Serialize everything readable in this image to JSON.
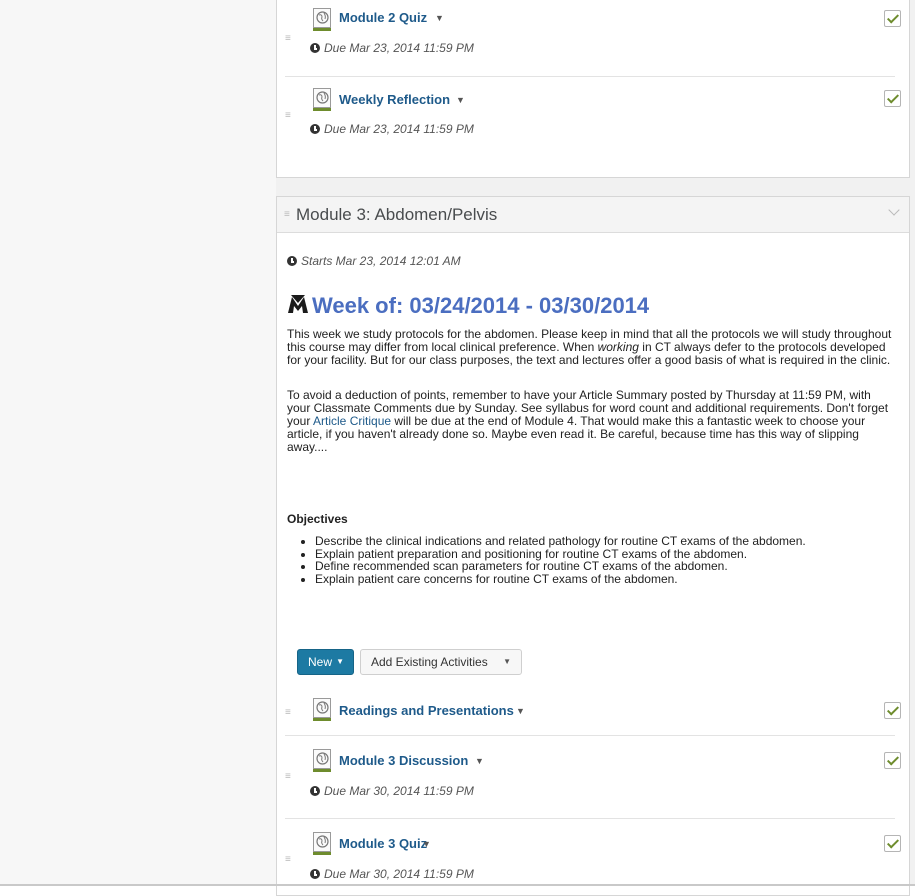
{
  "top_activities": [
    {
      "title": "Module 2 Quiz",
      "due": "Due Mar 23, 2014 11:59 PM"
    },
    {
      "title": "Weekly Reflection",
      "due": "Due Mar 23, 2014 11:59 PM"
    }
  ],
  "module3": {
    "title": "Module 3: Abdomen/Pelvis",
    "starts": "Starts Mar 23, 2014 12:01 AM",
    "week_heading": "Week of: 03/24/2014 - 03/30/2014",
    "para1_a": "This week we study protocols for the abdomen. Please keep in mind that all the protocols we will study throughout this course may differ from local clinical preference. When ",
    "para1_em": "working",
    "para1_b": " in CT always defer to the protocols developed for your facility.  But for our class purposes, the text and lectures offer a good basis of what is required in the clinic.",
    "para2_a": "To avoid a deduction of points, remember to have your Article Summary posted by Thursday at 11:59 PM, with your Classmate Comments due by Sunday. See syllabus for word count and additional requirements. Don't forget your ",
    "para2_link": "Article Critique",
    "para2_b": " will be due at the end of Module 4.  That would make this a fantastic week to choose your article, if you haven't already done so.  Maybe even read it.  Be careful, because time has this way of slipping away....",
    "objectives_title": "Objectives",
    "objectives": [
      "Describe the clinical indications and related pathology for routine CT exams of the abdomen.",
      "Explain patient preparation and positioning for routine CT exams of the abdomen.",
      "Define recommended scan parameters for routine CT exams of the abdomen.",
      "Explain patient care concerns for routine CT exams of the abdomen."
    ],
    "new_button": "New",
    "add_existing_button": "Add Existing Activities",
    "activities": [
      {
        "title": "Readings and Presentations",
        "due": ""
      },
      {
        "title": "Module 3 Discussion",
        "due": "Due Mar 30, 2014 11:59 PM"
      },
      {
        "title": "Module 3 Quiz",
        "due": "Due Mar 30, 2014 11:59 PM"
      }
    ]
  },
  "colors": {
    "link_blue": "#1e5a8a",
    "heading_blue": "#4b6ec0",
    "check_green": "#6e8c2d",
    "new_button": "#1d7aa3"
  },
  "icons": {
    "activity": "quiz-globe-icon",
    "completion": "checkmark-icon",
    "drag": "drag-handle-icon",
    "clock": "clock-icon"
  }
}
